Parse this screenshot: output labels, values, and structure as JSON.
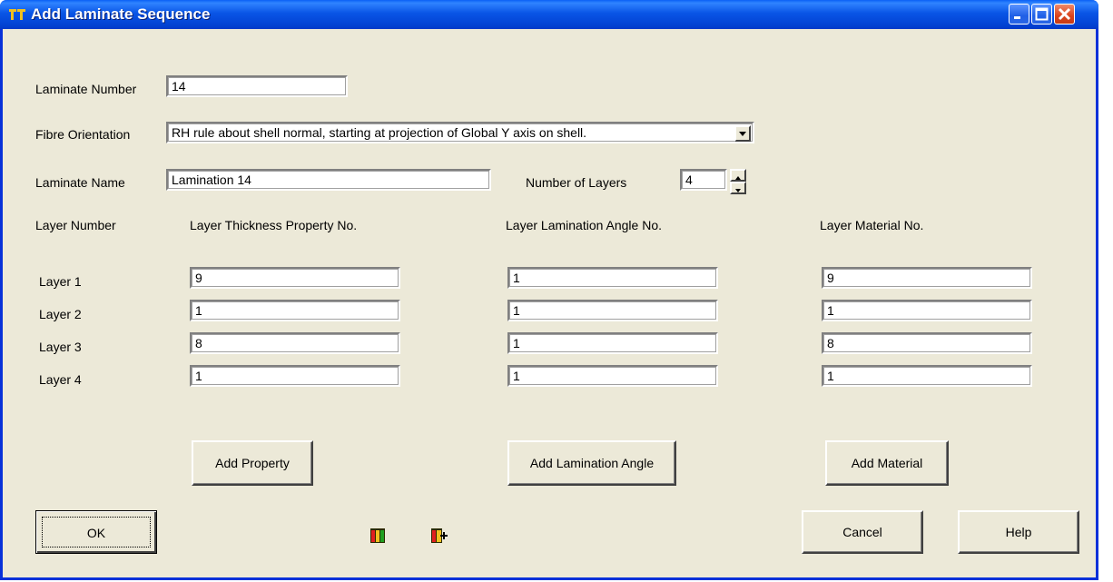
{
  "window": {
    "title": "Add Laminate Sequence"
  },
  "laminate_number": {
    "label": "Laminate Number",
    "value": "14"
  },
  "fibre_orientation": {
    "label": "Fibre Orientation",
    "value": "RH rule about shell normal, starting at projection of Global Y axis on shell."
  },
  "laminate_name": {
    "label": "Laminate Name",
    "value": "Lamination 14"
  },
  "number_of_layers": {
    "label": "Number of Layers",
    "value": "4"
  },
  "headers": {
    "layer_number": "Layer Number",
    "thickness": "Layer Thickness Property No.",
    "angle": "Layer Lamination Angle No.",
    "material": "Layer Material No."
  },
  "layers": [
    {
      "label": "Layer 1",
      "thickness": "9",
      "angle": "1",
      "material": "9"
    },
    {
      "label": "Layer 2",
      "thickness": "1",
      "angle": "1",
      "material": "1"
    },
    {
      "label": "Layer 3",
      "thickness": "8",
      "angle": "1",
      "material": "8"
    },
    {
      "label": "Layer 4",
      "thickness": "1",
      "angle": "1",
      "material": "1"
    }
  ],
  "buttons": {
    "add_property": "Add Property",
    "add_lamination_angle": "Add Lamination Angle",
    "add_material": "Add Material",
    "ok": "OK",
    "cancel": "Cancel",
    "help": "Help"
  },
  "icons": {
    "app": "app-logo-icon",
    "table": "table-icon",
    "table_add": "table-add-icon"
  },
  "colors": {
    "titlebar": "#0a55e6",
    "dialog_bg": "#ece9d8",
    "close": "#d9431c"
  }
}
